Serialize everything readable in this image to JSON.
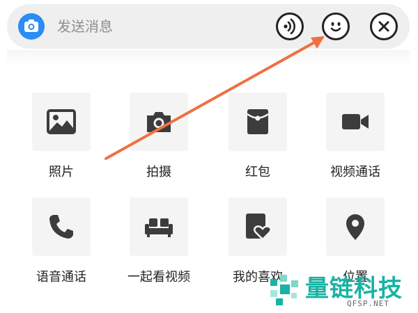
{
  "input_bar": {
    "placeholder": "发送消息",
    "camera_icon": "camera-icon",
    "voice_icon": "voice-icon",
    "emoji_icon": "smiley-face-icon",
    "close_icon": "close-x-icon",
    "accent_color": "#2b8cf3"
  },
  "panel": {
    "items": [
      {
        "label": "照片",
        "icon": "photo-icon"
      },
      {
        "label": "拍摄",
        "icon": "camera-icon"
      },
      {
        "label": "红包",
        "icon": "red-packet-icon"
      },
      {
        "label": "视频通话",
        "icon": "video-camera-icon"
      },
      {
        "label": "语音通话",
        "icon": "phone-icon"
      },
      {
        "label": "一起看视频",
        "icon": "sofa-icon"
      },
      {
        "label": "我的喜欢",
        "icon": "favorites-heart-icon"
      },
      {
        "label": "位置",
        "icon": "location-pin-icon"
      }
    ]
  },
  "annotation": {
    "arrow_color": "#f07040",
    "target": "emoji-button"
  },
  "watermark": {
    "name": "量链科技",
    "url": "QFSP.NET",
    "color": "#18b3a2"
  }
}
